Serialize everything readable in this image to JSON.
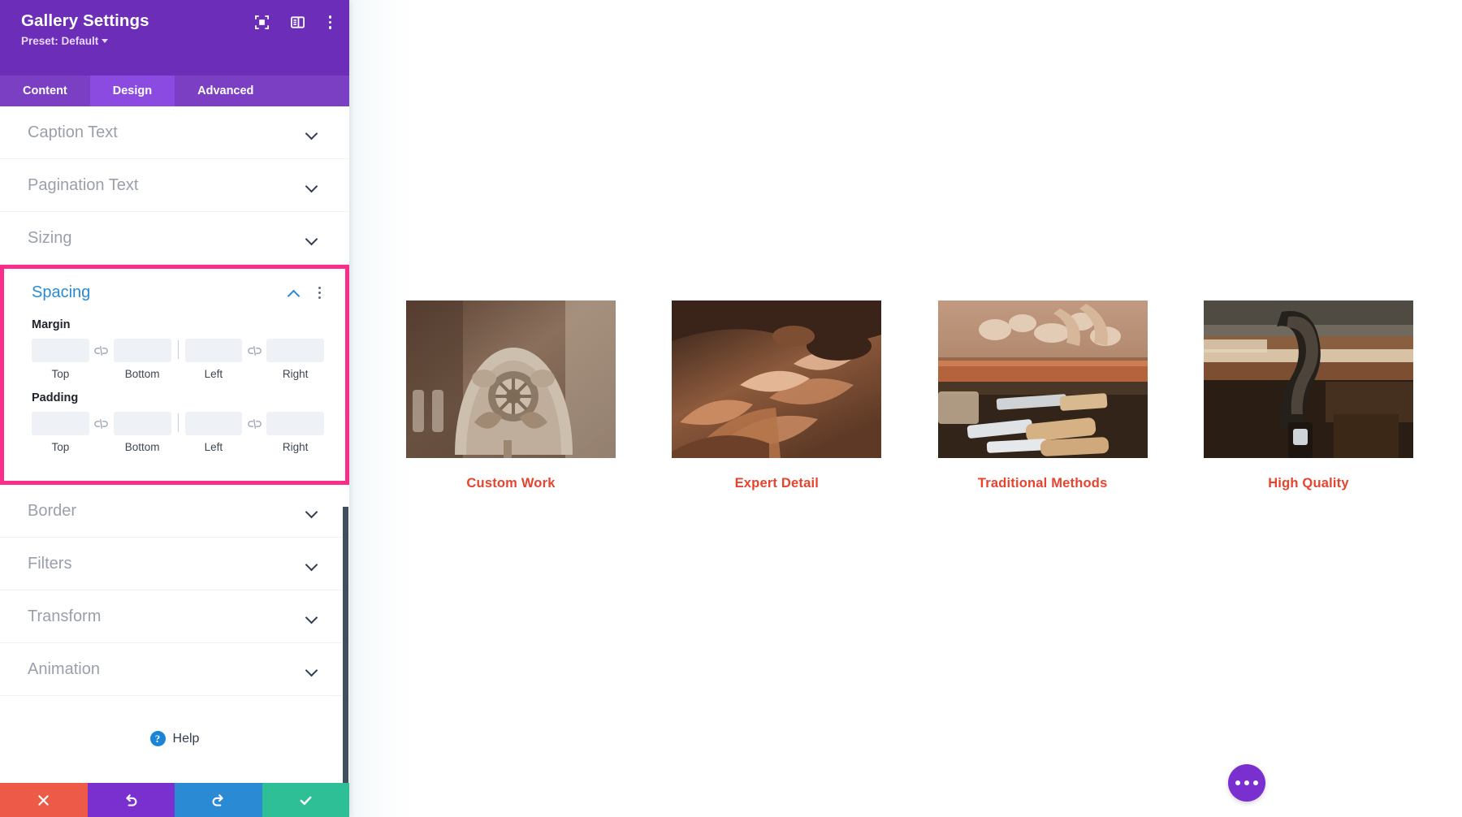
{
  "panel": {
    "title": "Gallery Settings",
    "preset_label": "Preset: Default",
    "header_icons": [
      {
        "name": "focus-icon",
        "label": "focus"
      },
      {
        "name": "layout-icon",
        "label": "layout"
      },
      {
        "name": "kebab-menu-icon",
        "label": "more options"
      }
    ],
    "tabs": [
      {
        "label": "Content",
        "active": false
      },
      {
        "label": "Design",
        "active": true
      },
      {
        "label": "Advanced",
        "active": false
      }
    ],
    "sections_above": [
      {
        "label": "Caption Text",
        "state": "collapsed"
      },
      {
        "label": "Pagination Text",
        "state": "collapsed"
      },
      {
        "label": "Sizing",
        "state": "collapsed"
      }
    ],
    "spacing": {
      "title": "Spacing",
      "state": "expanded",
      "highlighted": true,
      "highlight_color": "#fa2d8b",
      "title_color": "#2a8ad4",
      "groups": [
        {
          "label": "Margin",
          "fields": [
            {
              "label": "Top",
              "value": "",
              "placeholder": ""
            },
            {
              "label": "Bottom",
              "value": "",
              "placeholder": ""
            },
            {
              "label": "Left",
              "value": "",
              "placeholder": ""
            },
            {
              "label": "Right",
              "value": "",
              "placeholder": ""
            }
          ],
          "link_icon": "broken-link-icon"
        },
        {
          "label": "Padding",
          "fields": [
            {
              "label": "Top",
              "value": "",
              "placeholder": ""
            },
            {
              "label": "Bottom",
              "value": "",
              "placeholder": ""
            },
            {
              "label": "Left",
              "value": "",
              "placeholder": ""
            },
            {
              "label": "Right",
              "value": "",
              "placeholder": ""
            }
          ],
          "link_icon": "broken-link-icon"
        }
      ]
    },
    "sections_below": [
      {
        "label": "Border",
        "state": "collapsed"
      },
      {
        "label": "Filters",
        "state": "collapsed"
      },
      {
        "label": "Transform",
        "state": "collapsed"
      },
      {
        "label": "Animation",
        "state": "collapsed"
      }
    ],
    "help": {
      "label": "Help",
      "icon": "question-circle-icon"
    },
    "actions": [
      {
        "name": "cancel-button",
        "icon": "close-icon",
        "color": "#ee5a48"
      },
      {
        "name": "undo-button",
        "icon": "undo-icon",
        "color": "#7a2fcf"
      },
      {
        "name": "redo-button",
        "icon": "redo-icon",
        "color": "#2a8ad4"
      },
      {
        "name": "save-button",
        "icon": "check-icon",
        "color": "#2fbf96"
      }
    ],
    "colors": {
      "header_purple": "#6c2eb9",
      "tabbar_purple": "#7b3fc4",
      "tab_active_purple": "#8b4ae0",
      "highlight_pink": "#fa2d8b",
      "accent_blue": "#2a8ad4"
    }
  },
  "canvas": {
    "gallery": {
      "caption_color": "#e8432f",
      "items": [
        {
          "caption": "Custom Work",
          "alt": "Carved wooden chair back detail"
        },
        {
          "caption": "Expert Detail",
          "alt": "Close-up of ornate carved wood leaves"
        },
        {
          "caption": "Traditional Methods",
          "alt": "Hands carving wood with chisels on a bench"
        },
        {
          "caption": "High Quality",
          "alt": "Metal clamp holding wood on a workbench"
        }
      ]
    },
    "fab": {
      "name": "page-settings-fab",
      "icon": "ellipsis-icon",
      "color": "#7a2fcf"
    }
  }
}
